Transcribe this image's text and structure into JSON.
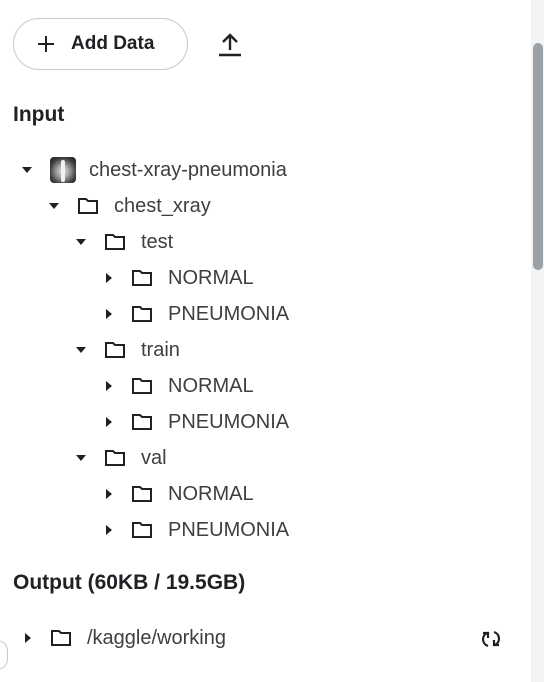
{
  "toolbar": {
    "add_data_label": "Add Data",
    "add_data_icon": "plus-icon",
    "upload_icon": "upload-icon"
  },
  "input": {
    "title": "Input",
    "dataset": {
      "label": "chest-xray-pneumonia",
      "expanded": true,
      "children": [
        {
          "label": "chest_xray",
          "expanded": true,
          "children": [
            {
              "label": "test",
              "expanded": true,
              "children": [
                {
                  "label": "NORMAL",
                  "expanded": false
                },
                {
                  "label": "PNEUMONIA",
                  "expanded": false
                }
              ]
            },
            {
              "label": "train",
              "expanded": true,
              "children": [
                {
                  "label": "NORMAL",
                  "expanded": false
                },
                {
                  "label": "PNEUMONIA",
                  "expanded": false
                }
              ]
            },
            {
              "label": "val",
              "expanded": true,
              "children": [
                {
                  "label": "NORMAL",
                  "expanded": false
                },
                {
                  "label": "PNEUMONIA",
                  "expanded": false
                }
              ]
            }
          ]
        }
      ]
    }
  },
  "output": {
    "title": "Output (60KB / 19.5GB)",
    "folder": {
      "label": "/kaggle/working",
      "expanded": false
    },
    "refresh_icon": "refresh-icon"
  },
  "colors": {
    "text": "#202124",
    "tree_text": "#3c4043",
    "border": "#c6c9cc",
    "scrollbar_thumb": "#9aa0a6"
  }
}
